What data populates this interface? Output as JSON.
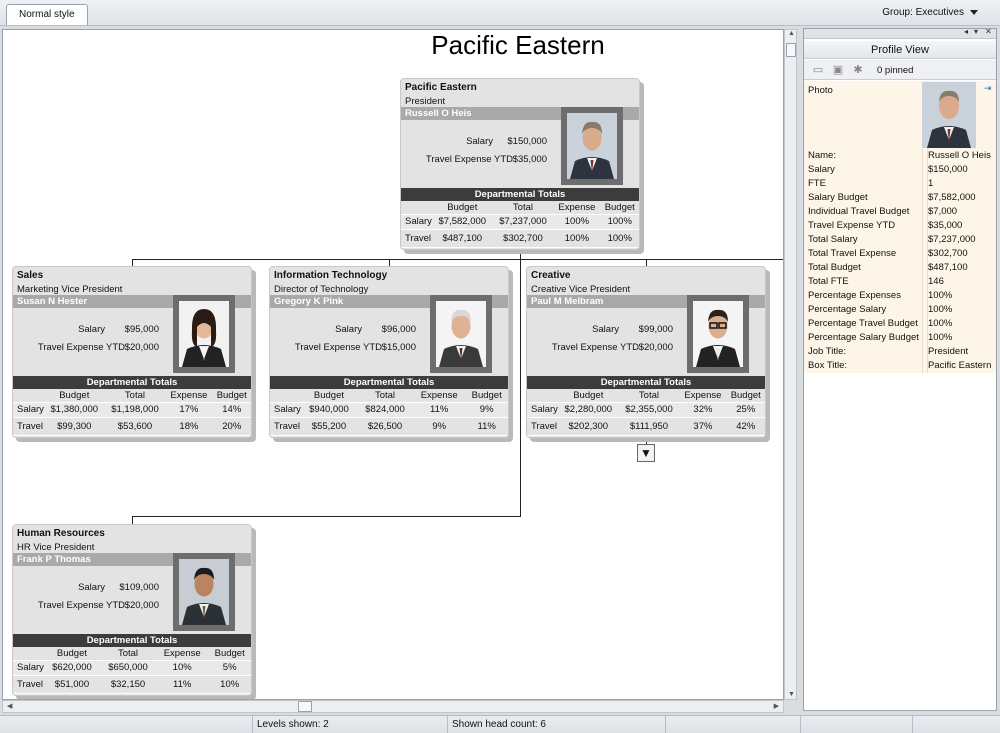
{
  "tab": {
    "label": "Normal style"
  },
  "group": {
    "label": "Group: Executives"
  },
  "chart": {
    "title": "Pacific Eastern"
  },
  "table_headers": {
    "budget": "Budget",
    "total": "Total",
    "expense": "Expense",
    "budget2": "Budget",
    "salary_row": "Salary",
    "travel_row": "Travel",
    "dept_totals": "Departmental Totals",
    "salary_label": "Salary",
    "travel_label": "Travel Expense YTD"
  },
  "cards": {
    "ceo": {
      "dept": "Pacific Eastern",
      "role": "President",
      "name": "Russell O Heis",
      "salary": "$150,000",
      "travel": "$35,000",
      "salary_row": [
        "$7,582,000",
        "$7,237,000",
        "100%",
        "100%"
      ],
      "travel_row": [
        "$487,100",
        "$302,700",
        "100%",
        "100%"
      ]
    },
    "sales": {
      "dept": "Sales",
      "role": "Marketing Vice President",
      "name": "Susan N Hester",
      "salary": "$95,000",
      "travel": "$20,000",
      "salary_row": [
        "$1,380,000",
        "$1,198,000",
        "17%",
        "14%"
      ],
      "travel_row": [
        "$99,300",
        "$53,600",
        "18%",
        "20%"
      ]
    },
    "it": {
      "dept": "Information Technology",
      "role": "Director of Technology",
      "name": "Gregory K Pink",
      "salary": "$96,000",
      "travel": "$15,000",
      "salary_row": [
        "$940,000",
        "$824,000",
        "11%",
        "9%"
      ],
      "travel_row": [
        "$55,200",
        "$26,500",
        "9%",
        "11%"
      ]
    },
    "creative": {
      "dept": "Creative",
      "role": "Creative Vice President",
      "name": "Paul M Melbram",
      "salary": "$99,000",
      "travel": "$20,000",
      "salary_row": [
        "$2,280,000",
        "$2,355,000",
        "32%",
        "25%"
      ],
      "travel_row": [
        "$202,300",
        "$111,950",
        "37%",
        "42%"
      ]
    },
    "hr": {
      "dept": "Human Resources",
      "role": "HR Vice President",
      "name": "Frank P Thomas",
      "salary": "$109,000",
      "travel": "$20,000",
      "salary_row": [
        "$620,000",
        "$650,000",
        "10%",
        "5%"
      ],
      "travel_row": [
        "$51,000",
        "$32,150",
        "11%",
        "10%"
      ]
    }
  },
  "panel": {
    "title": "Profile View",
    "pinned": "0 pinned",
    "photo_label": "Photo",
    "props": [
      {
        "k": "Name:",
        "v": "Russell O Heis"
      },
      {
        "k": "Salary",
        "v": "$150,000"
      },
      {
        "k": "FTE",
        "v": "1"
      },
      {
        "k": "Salary Budget",
        "v": "$7,582,000"
      },
      {
        "k": "Individual Travel Budget",
        "v": "$7,000"
      },
      {
        "k": "Travel Expense YTD",
        "v": "$35,000"
      },
      {
        "k": "Total Salary",
        "v": "$7,237,000"
      },
      {
        "k": "Total Travel Expense",
        "v": "$302,700"
      },
      {
        "k": "Total Budget",
        "v": "$487,100"
      },
      {
        "k": "Total FTE",
        "v": "146"
      },
      {
        "k": "Percentage Expenses",
        "v": "100%"
      },
      {
        "k": "Percentage Salary",
        "v": "100%"
      },
      {
        "k": "Percentage Travel Budget",
        "v": "100%"
      },
      {
        "k": "Percentage Salary Budget",
        "v": "100%"
      },
      {
        "k": "Job Title:",
        "v": "President"
      },
      {
        "k": "Box Title:",
        "v": "Pacific Eastern"
      }
    ]
  },
  "status": {
    "levels": "Levels shown: 2",
    "headcount": "Shown head count: 6"
  }
}
